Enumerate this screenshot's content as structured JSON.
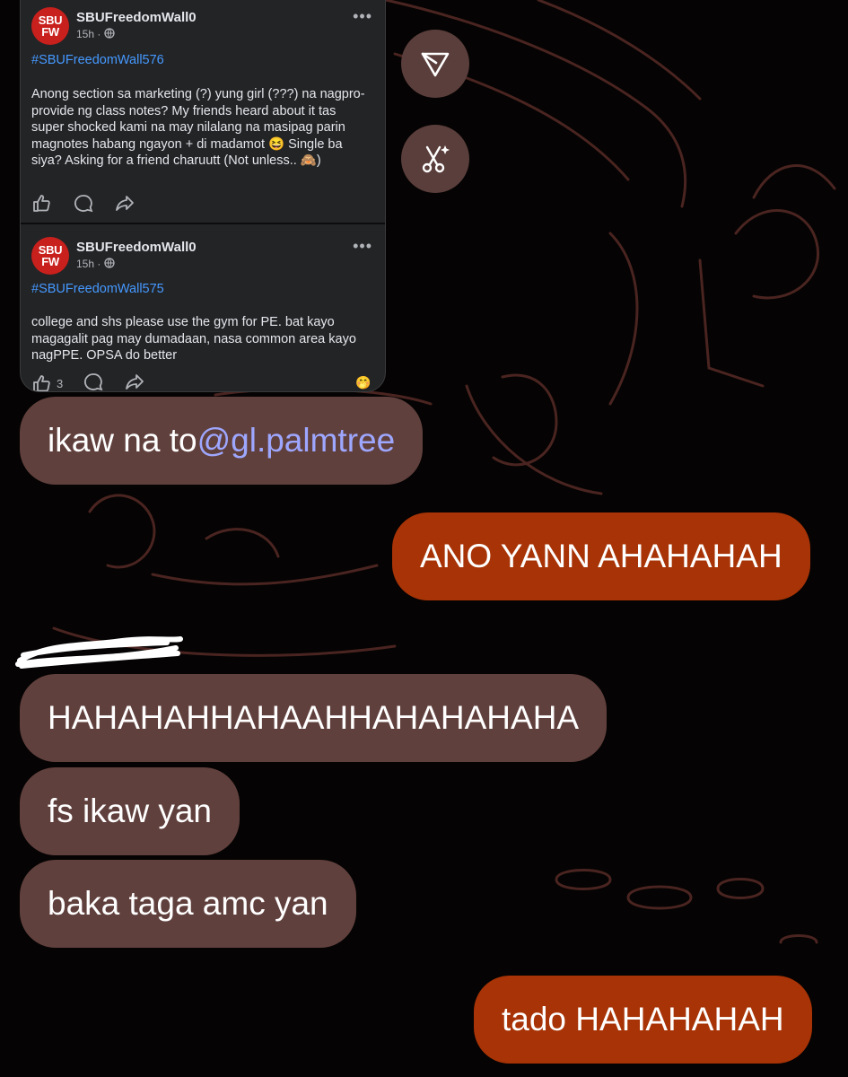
{
  "shared_posts": [
    {
      "avatar_line1": "SBU",
      "avatar_line2": "FW",
      "author": "SBUFreedomWall0",
      "time": "15h",
      "privacy_icon": "globe-icon",
      "hashtag": "#SBUFreedomWall576",
      "body": "Anong section sa marketing (?) yung girl (???) na nagpro-provide ng class notes? My friends heard about it tas super shocked kami na may nilalang na masipag parin magnotes habang ngayon + di madamot 😆 Single ba siya? Asking for a friend charuutt (Not unless.. 🙈)",
      "like_count": ""
    },
    {
      "avatar_line1": "SBU",
      "avatar_line2": "FW",
      "author": "SBUFreedomWall0",
      "time": "15h",
      "privacy_icon": "globe-icon",
      "hashtag": "#SBUFreedomWall575",
      "body": "college and shs please use the gym for PE. bat kayo magagalit pag may dumadaan, nasa common area kayo nagPPE. OPSA do better",
      "like_count": "3"
    }
  ],
  "floating_buttons": [
    {
      "icon": "share-arrow-icon"
    },
    {
      "icon": "ai-scissors-icon"
    }
  ],
  "messages": [
    {
      "direction": "incoming",
      "text": "ikaw na to ",
      "mention": "@gl.palmtree"
    },
    {
      "direction": "outgoing",
      "text": "ANO YANN AHAHAHAH"
    },
    {
      "direction": "incoming",
      "text": "HAHAHAHHAHAAHHAHAHAHAHA"
    },
    {
      "direction": "incoming",
      "text": "fs ikaw yan"
    },
    {
      "direction": "incoming",
      "text": "baka taga amc yan"
    },
    {
      "direction": "outgoing",
      "text": "tado HAHAHAHAH"
    }
  ],
  "colors": {
    "background": "#050303",
    "incoming_bubble": "#60403d",
    "outgoing_bubble": "#a73306",
    "mention": "#9ea7ff",
    "hashtag": "#4599ff",
    "card": "#232426"
  }
}
